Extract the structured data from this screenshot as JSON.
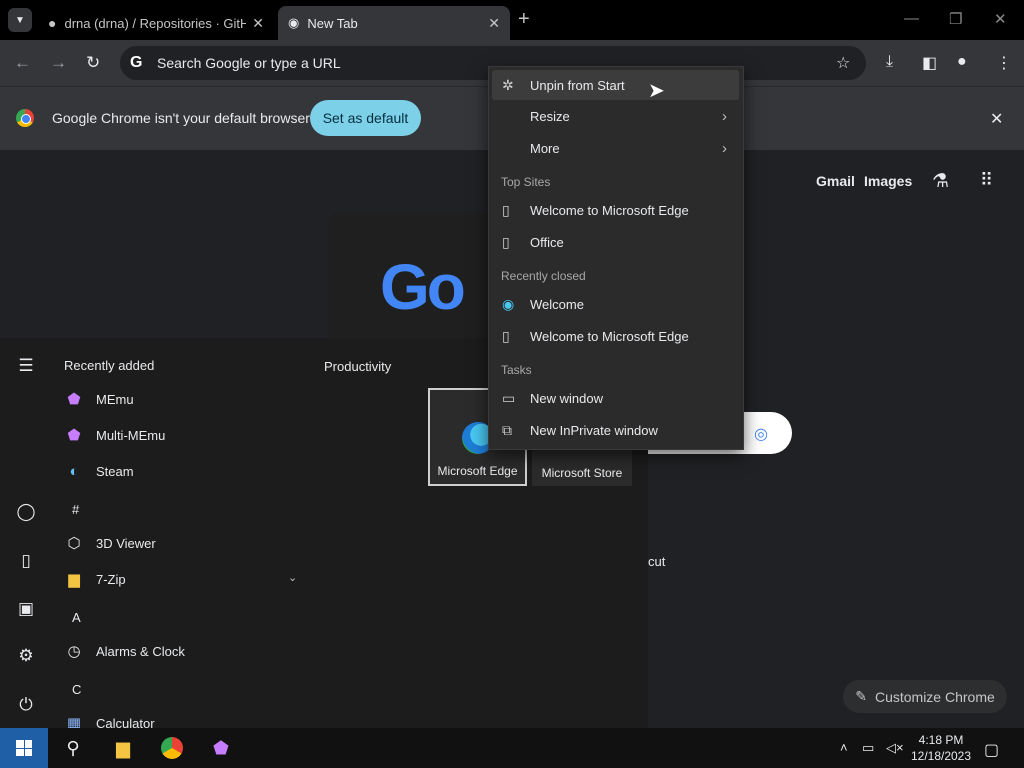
{
  "browser": {
    "tabs": [
      {
        "title": "drna (drna) / Repositories · GitH"
      },
      {
        "title": "New Tab"
      }
    ],
    "omnibox": {
      "placeholder": "Search Google or type a URL"
    },
    "infobar": {
      "message": "Google Chrome isn't your default browser",
      "set_default_label": "Set as default"
    },
    "ntp": {
      "links": [
        "Gmail",
        "Images"
      ],
      "doodle_text": "Go",
      "partial_shortcut_text": "cut",
      "customize_label": "Customize Chrome"
    }
  },
  "start_menu": {
    "recently_added_header": "Recently added",
    "productivity_header": "Productivity",
    "apps": [
      {
        "label": "MEmu"
      },
      {
        "label": "Multi-MEmu"
      },
      {
        "label": "Steam"
      },
      {
        "label": "3D Viewer"
      },
      {
        "label": "7-Zip"
      },
      {
        "label": "Alarms & Clock"
      },
      {
        "label": "Calculator"
      }
    ],
    "letters": [
      "#",
      "A",
      "C"
    ],
    "tiles": [
      {
        "label": "Microsoft Edge"
      },
      {
        "label": "Microsoft Store"
      }
    ]
  },
  "context_menu": {
    "items": [
      {
        "label": "Unpin from Start",
        "icon": "unpin-icon"
      },
      {
        "label": "Resize",
        "icon": "none"
      },
      {
        "label": "More",
        "icon": "none"
      }
    ],
    "sections": {
      "top_sites": "Top Sites",
      "recently_closed": "Recently closed",
      "tasks": "Tasks"
    },
    "top_sites": [
      {
        "label": "Welcome to Microsoft Edge"
      },
      {
        "label": "Office"
      }
    ],
    "recently_closed": [
      {
        "label": "Welcome"
      },
      {
        "label": "Welcome to Microsoft Edge"
      }
    ],
    "tasks": [
      {
        "label": "New window"
      },
      {
        "label": "New InPrivate window"
      }
    ]
  },
  "taskbar": {
    "time": "4:18 PM",
    "date": "12/18/2023"
  },
  "colors": {
    "set_default_bg": "#7cd0e8",
    "start_button": "#1e5fa6"
  }
}
